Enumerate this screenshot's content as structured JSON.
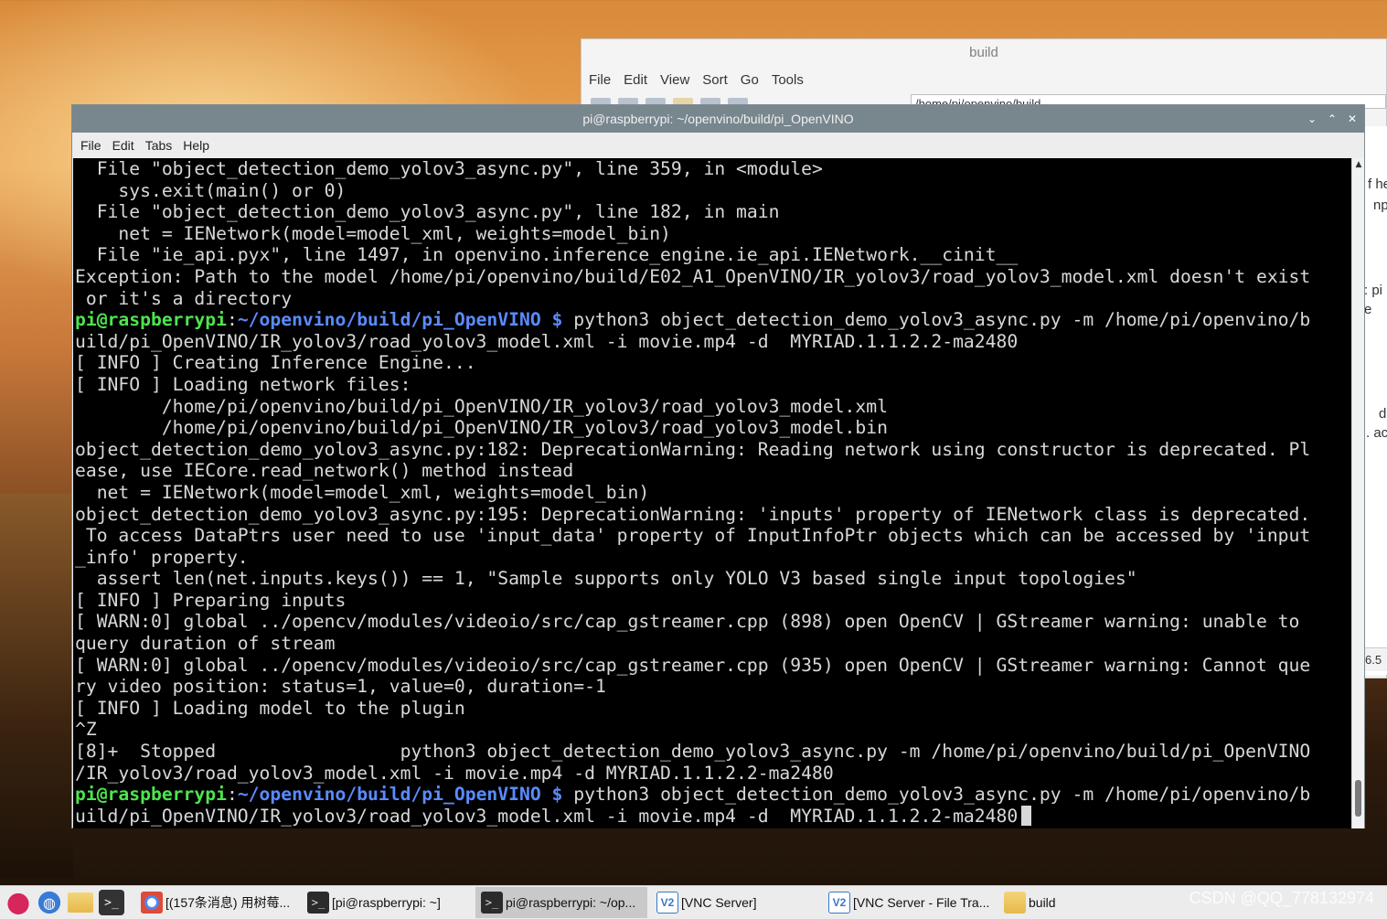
{
  "file_manager": {
    "title": "build",
    "menu": [
      "File",
      "Edit",
      "View",
      "Sort",
      "Go",
      "Tools"
    ],
    "path": "/home/pi/openvino/build",
    "side_fragments": [
      "f he",
      "np",
      ": pi",
      "e",
      "d",
      ". ac"
    ],
    "status_fragment": "6.5"
  },
  "terminal": {
    "title": "pi@raspberrypi: ~/openvino/build/pi_OpenVINO",
    "controls": [
      "⌄",
      "⌃",
      "✕"
    ],
    "menu": [
      "File",
      "Edit",
      "Tabs",
      "Help"
    ],
    "prompt_user": "pi@raspberrypi",
    "prompt_sep": ":",
    "prompt_path": "~/openvino/build/pi_OpenVINO $",
    "lines": [
      "  File \"object_detection_demo_yolov3_async.py\", line 359, in <module>",
      "    sys.exit(main() or 0)",
      "  File \"object_detection_demo_yolov3_async.py\", line 182, in main",
      "    net = IENetwork(model=model_xml, weights=model_bin)",
      "  File \"ie_api.pyx\", line 1497, in openvino.inference_engine.ie_api.IENetwork.__cinit__",
      "Exception: Path to the model /home/pi/openvino/build/E02_A1_OpenVINO/IR_yolov3/road_yolov3_model.xml doesn't exist",
      " or it's a directory",
      "PROMPT1",
      "uild/pi_OpenVINO/IR_yolov3/road_yolov3_model.xml -i movie.mp4 -d  MYRIAD.1.1.2.2-ma2480",
      "[ INFO ] Creating Inference Engine...",
      "[ INFO ] Loading network files:",
      "        /home/pi/openvino/build/pi_OpenVINO/IR_yolov3/road_yolov3_model.xml",
      "        /home/pi/openvino/build/pi_OpenVINO/IR_yolov3/road_yolov3_model.bin",
      "object_detection_demo_yolov3_async.py:182: DeprecationWarning: Reading network using constructor is deprecated. Pl",
      "ease, use IECore.read_network() method instead",
      "  net = IENetwork(model=model_xml, weights=model_bin)",
      "object_detection_demo_yolov3_async.py:195: DeprecationWarning: 'inputs' property of IENetwork class is deprecated.",
      " To access DataPtrs user need to use 'input_data' property of InputInfoPtr objects which can be accessed by 'input",
      "_info' property.",
      "  assert len(net.inputs.keys()) == 1, \"Sample supports only YOLO V3 based single input topologies\"",
      "[ INFO ] Preparing inputs",
      "[ WARN:0] global ../opencv/modules/videoio/src/cap_gstreamer.cpp (898) open OpenCV | GStreamer warning: unable to",
      "query duration of stream",
      "[ WARN:0] global ../opencv/modules/videoio/src/cap_gstreamer.cpp (935) open OpenCV | GStreamer warning: Cannot que",
      "ry video position: status=1, value=0, duration=-1",
      "[ INFO ] Loading model to the plugin",
      "^Z",
      "[8]+  Stopped                 python3 object_detection_demo_yolov3_async.py -m /home/pi/openvino/build/pi_OpenVINO",
      "/IR_yolov3/road_yolov3_model.xml -i movie.mp4 -d MYRIAD.1.1.2.2-ma2480",
      "PROMPT2",
      "uild/pi_OpenVINO/IR_yolov3/road_yolov3_model.xml -i movie.mp4 -d  MYRIAD.1.1.2.2-ma2480"
    ],
    "prompt1_cmd": " python3 object_detection_demo_yolov3_async.py -m /home/pi/openvino/b",
    "prompt2_cmd": " python3 object_detection_demo_yolov3_async.py -m /home/pi/openvino/b"
  },
  "taskbar": {
    "launchers": [
      "raspberry-menu-icon",
      "browser-icon",
      "file-manager-icon",
      "terminal-icon"
    ],
    "tasks": [
      {
        "label": "[(157条消息) 用树莓...",
        "icon": "chrome"
      },
      {
        "label": "[pi@raspberrypi: ~]",
        "icon": "terminal"
      },
      {
        "label": "pi@raspberrypi: ~/op...",
        "icon": "terminal"
      },
      {
        "label": "[VNC Server]",
        "icon": "vnc"
      },
      {
        "label": "[VNC Server - File Tra...",
        "icon": "vnc"
      },
      {
        "label": "build",
        "icon": "folder"
      }
    ],
    "watermark": "CSDN @QQ_778132974"
  }
}
